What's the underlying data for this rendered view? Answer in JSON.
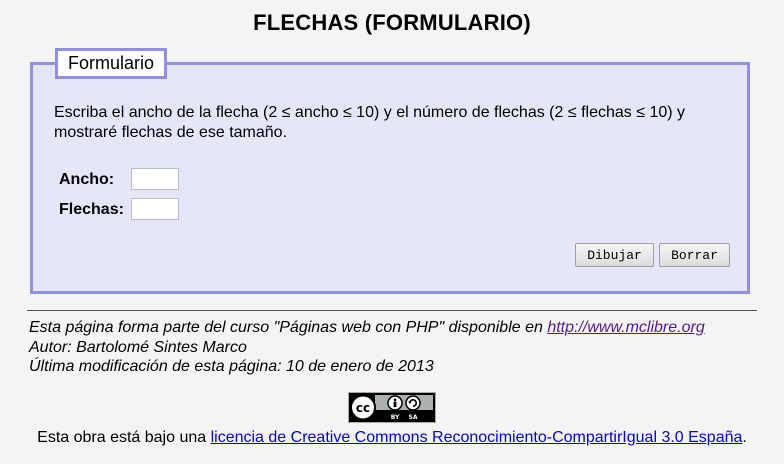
{
  "page_title": "FLECHAS (FORMULARIO)",
  "form": {
    "legend": "Formulario",
    "intro": "Escriba el ancho de la flecha (2 ≤ ancho ≤ 10) y el número de flechas (2 ≤ flechas ≤ 10) y mostraré flechas de ese tamaño.",
    "fields": {
      "ancho": {
        "label": "Ancho:",
        "value": ""
      },
      "flechas": {
        "label": "Flechas:",
        "value": ""
      }
    },
    "buttons": {
      "draw": "Dibujar",
      "clear": "Borrar"
    }
  },
  "footer": {
    "course_prefix": "Esta página forma parte del curso \"Páginas web con PHP\" disponible en ",
    "course_link": "http://www.mclibre.org",
    "author": "Autor: Bartolomé Sintes Marco",
    "modified": "Última modificación de esta página: 10 de enero de 2013",
    "badge": {
      "cc": "cc",
      "by": "BY",
      "sa": "SA"
    },
    "license_prefix": "Esta obra está bajo una ",
    "license_link": "licencia de Creative Commons Reconocimiento-CompartirIgual 3.0 España",
    "license_suffix": "."
  }
}
